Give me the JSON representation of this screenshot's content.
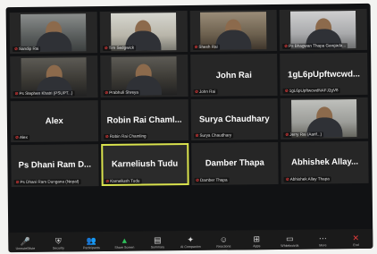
{
  "tiles": [
    {
      "name": "",
      "label": "Sandip Rai",
      "video": true
    },
    {
      "name": "",
      "label": "Tim Sedgwick",
      "video": true
    },
    {
      "name": "",
      "label": "Shesh Rai",
      "video": true
    },
    {
      "name": "",
      "label": "Ps Bhagwan Thapa Gangada...",
      "video": true
    },
    {
      "name": "",
      "label": "Ps Stephen Khatri (PSUPT...)",
      "video": true
    },
    {
      "name": "",
      "label": "Prabhuli Shreya",
      "video": true
    },
    {
      "name": "John Rai",
      "label": "John Rai",
      "video": false
    },
    {
      "name": "1gL6pUpftwcwd...",
      "label": "1gL6pUpftwcwdNAFJ2gV8",
      "video": false
    },
    {
      "name": "Alex",
      "label": "Alex",
      "video": false
    },
    {
      "name": "Robin Rai Chaml...",
      "label": "Robin Rai Chamling",
      "video": false
    },
    {
      "name": "Surya Chaudhary",
      "label": "Surya Chaudhary",
      "video": false
    },
    {
      "name": "",
      "label": "Jerry Rai (Aarif...)",
      "video": true
    },
    {
      "name": "Ps Dhani Ram D...",
      "label": "Ps Dhani Ram Dungana (Nepal)",
      "video": false
    },
    {
      "name": "Karneliush Tudu",
      "label": "Karneliush Tudu",
      "video": false
    },
    {
      "name": "Damber Thapa",
      "label": "Damber Thapa",
      "video": false
    },
    {
      "name": "Abhishek Allay...",
      "label": "Abhishek Allay Thapa",
      "video": false
    }
  ],
  "toolbar": [
    {
      "icon": "mic-icon",
      "glyph": "🎤",
      "label": "Unmute/Mute"
    },
    {
      "icon": "shield-icon",
      "glyph": "⛨",
      "label": "Security"
    },
    {
      "icon": "participants-icon",
      "glyph": "👥",
      "label": "Participants"
    },
    {
      "icon": "share-screen-icon",
      "glyph": "▲",
      "label": "Share Screen"
    },
    {
      "icon": "summary-icon",
      "glyph": "▤",
      "label": "Summary"
    },
    {
      "icon": "ai-companion-icon",
      "glyph": "✦",
      "label": "AI Companion"
    },
    {
      "icon": "reactions-icon",
      "glyph": "☺",
      "label": "Reactions"
    },
    {
      "icon": "apps-icon",
      "glyph": "⊞",
      "label": "Apps"
    },
    {
      "icon": "whiteboards-icon",
      "glyph": "▭",
      "label": "Whiteboards"
    },
    {
      "icon": "more-icon",
      "glyph": "⋯",
      "label": "More"
    },
    {
      "icon": "end-icon",
      "glyph": "✕",
      "label": "End"
    }
  ]
}
